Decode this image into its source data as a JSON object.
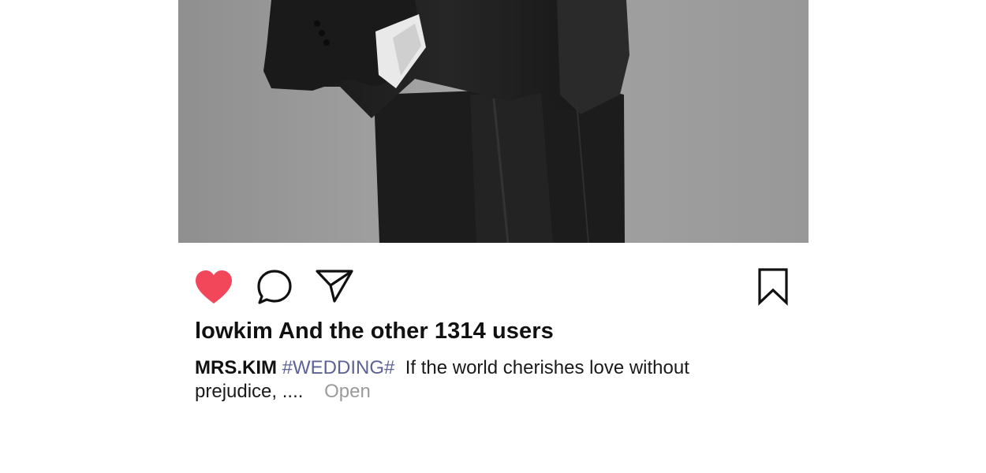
{
  "post": {
    "image_description_icon": "photo",
    "likes_text": "lowkim And the other 1314 users",
    "caption": {
      "username": "MRS.KIM",
      "hashtag": "#WEDDING#",
      "text_line1": "If the world cherishes love without",
      "text_line2": "prejudice, ....",
      "more_label": "Open"
    }
  },
  "actions": {
    "like_icon": "heart-filled",
    "comment_icon": "speech-bubble",
    "share_icon": "paper-plane",
    "save_icon": "bookmark"
  },
  "colors": {
    "like_color": "#f2475b",
    "hashtag_color": "#5d6296",
    "muted_text": "#9b9b9b"
  }
}
